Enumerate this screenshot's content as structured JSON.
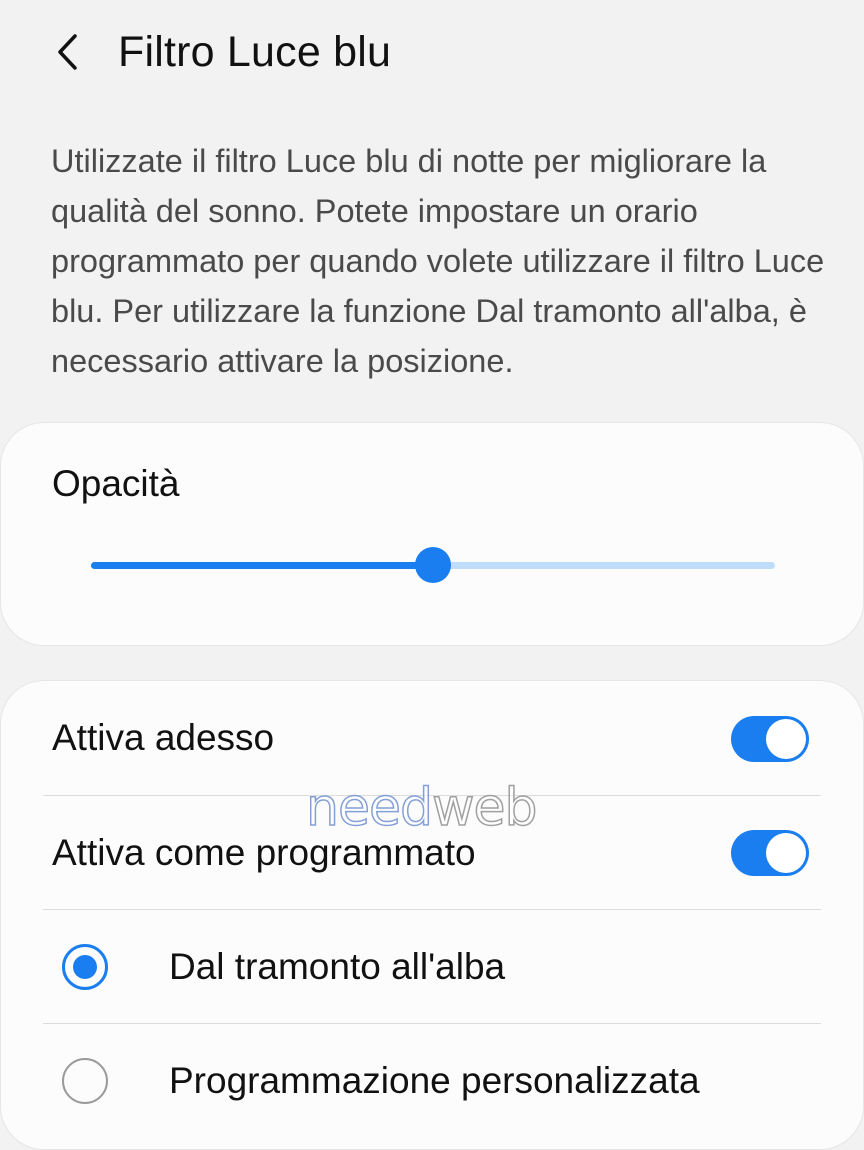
{
  "header": {
    "back_icon": "chevron-left-icon",
    "title": "Filtro Luce blu"
  },
  "description": "Utilizzate il filtro Luce blu di notte per migliorare la qualità del sonno. Potete impostare un orario programmato per quando volete utilizzare il filtro Luce blu. Per utilizzare la funzione Dal tramonto all'alba, è necessario attivare la posizione.",
  "opacity": {
    "label": "Opacità",
    "slider_value_percent": 50
  },
  "settings": {
    "activate_now": {
      "label": "Attiva adesso",
      "enabled": true
    },
    "activate_scheduled": {
      "label": "Attiva come programmato",
      "enabled": true
    },
    "options": [
      {
        "label": "Dal tramonto all'alba",
        "selected": true
      },
      {
        "label": "Programmazione personalizzata",
        "selected": false
      }
    ]
  },
  "watermark": {
    "part1": "need",
    "part2": "web"
  },
  "colors": {
    "accent": "#1a7ef0",
    "accent_light": "#bfdcfa",
    "background": "#f2f2f2",
    "card": "#fcfcfc"
  }
}
